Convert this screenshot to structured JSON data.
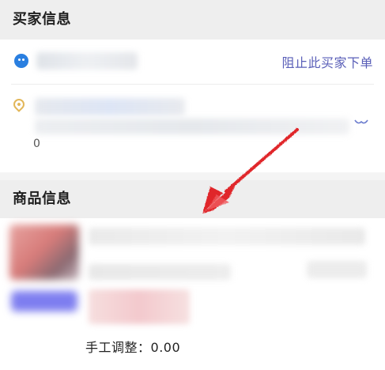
{
  "buyer_section": {
    "title": "买家信息",
    "block_buyer_label": "阻止此买家下单",
    "address_extra": "0"
  },
  "goods_section": {
    "title": "商品信息",
    "manual_adjust_label": "手工调整：",
    "manual_adjust_value": "0.00"
  },
  "icons": {
    "buyer_avatar": "buyer-avatar-icon",
    "location": "location-pin-icon",
    "expand": "expand-chevron-icon"
  },
  "colors": {
    "link": "#5a5fb8",
    "avatar": "#2a7fe0",
    "location": "#e2b75a",
    "annotation_arrow": "#e0262b",
    "section_header_bg": "#eeeeee"
  }
}
